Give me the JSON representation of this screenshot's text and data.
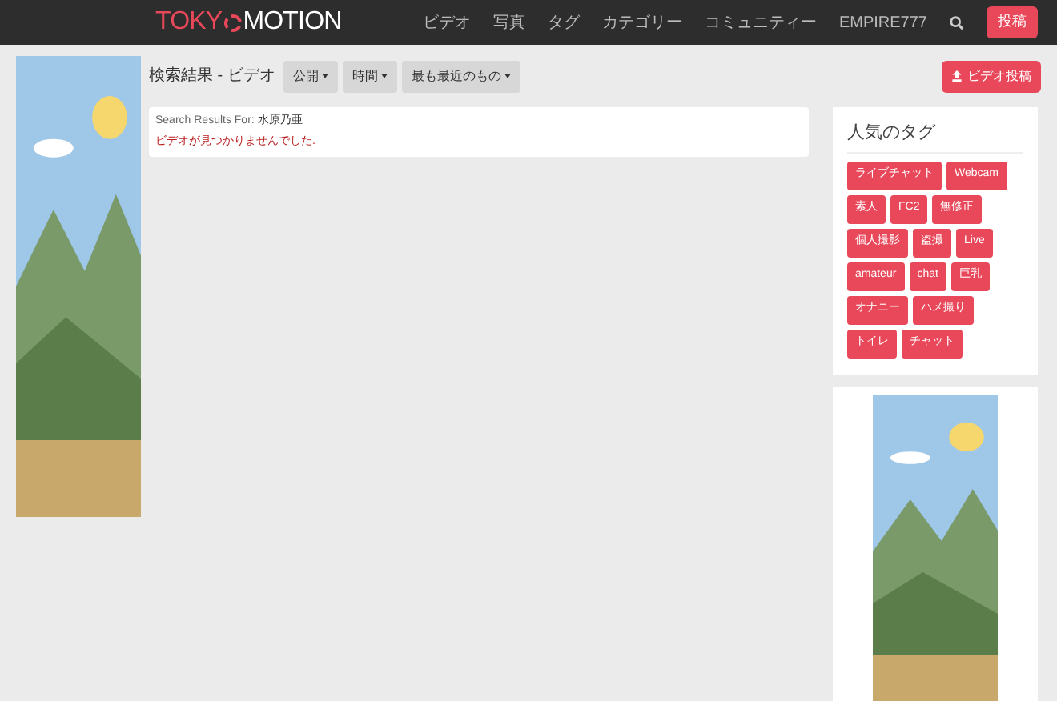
{
  "header": {
    "logo_left": "TOKY",
    "logo_right": "MOTION",
    "nav": [
      "ビデオ",
      "写真",
      "タグ",
      "カテゴリー",
      "コミュニティー",
      "EMPIRE777"
    ],
    "post_button": "投稿"
  },
  "toolbar": {
    "title": "検索結果 - ビデオ",
    "filters": [
      "公開",
      "時間",
      "最も最近のもの"
    ],
    "upload_button": "ビデオ投稿"
  },
  "results": {
    "query_label": "Search Results For:",
    "query": "水原乃亜",
    "message": "ビデオが見つかりませんでした."
  },
  "popular_tags": {
    "title": "人気のタグ",
    "tags": [
      "ライブチャット",
      "Webcam",
      "素人",
      "FC2",
      "無修正",
      "個人撮影",
      "盗撮",
      "Live",
      "amateur",
      "chat",
      "巨乳",
      "オナニー",
      "ハメ撮り",
      "トイレ",
      "チャット"
    ]
  }
}
